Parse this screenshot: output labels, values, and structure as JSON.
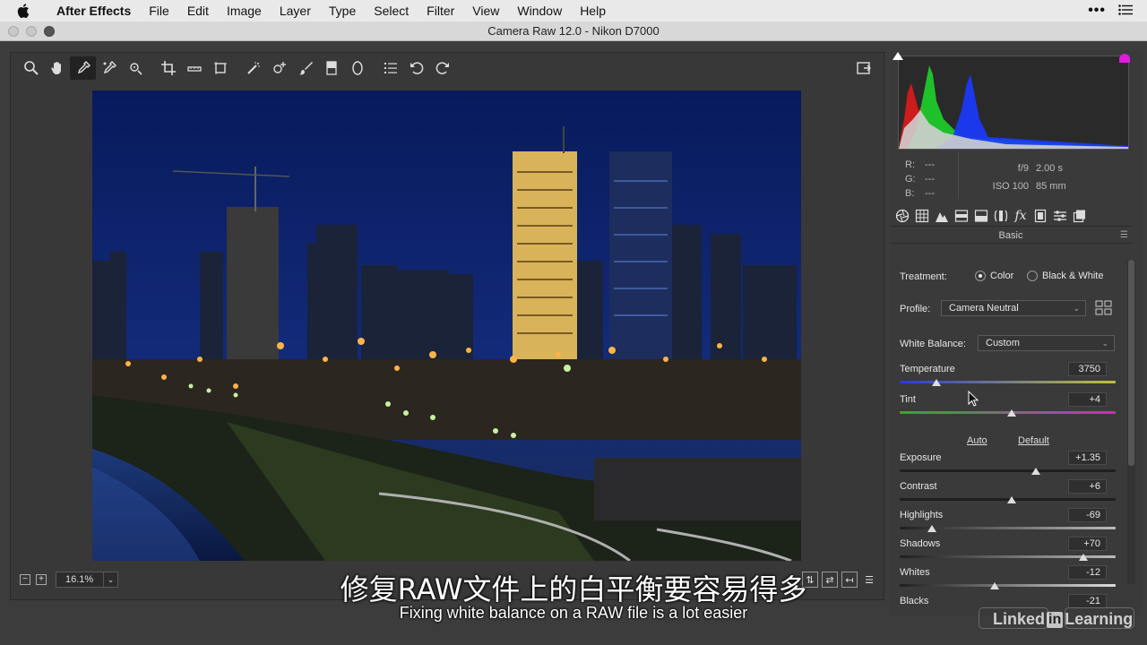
{
  "menubar": {
    "app": "After Effects",
    "items": [
      "File",
      "Edit",
      "Image",
      "Layer",
      "Type",
      "Select",
      "Filter",
      "View",
      "Window",
      "Help"
    ]
  },
  "window": {
    "title": "Camera Raw 12.0  -  Nikon D7000"
  },
  "toolbar": {
    "tools": [
      "zoom-tool",
      "hand-tool",
      "white-balance-tool",
      "color-sampler-tool",
      "targeted-adjustment-tool",
      "crop-tool",
      "straighten-tool",
      "transform-tool",
      "spot-removal-tool",
      "red-eye-tool",
      "adjustment-brush",
      "graduated-filter",
      "radial-filter",
      "preferences",
      "rotate-left",
      "rotate-right"
    ],
    "active_tool": "white-balance-tool"
  },
  "bottom": {
    "zoom_out": "−",
    "zoom_in": "+",
    "zoom": "16.1%"
  },
  "info": {
    "r_label": "R:",
    "r_value": "---",
    "g_label": "G:",
    "g_value": "---",
    "b_label": "B:",
    "b_value": "---",
    "aperture": "f/9",
    "shutter": "2.00 s",
    "iso": "ISO 100",
    "focal": "85 mm"
  },
  "panel": {
    "section": "Basic",
    "treatment_label": "Treatment:",
    "treatment_color": "Color",
    "treatment_bw": "Black & White",
    "profile_label": "Profile:",
    "profile_value": "Camera Neutral",
    "wb_label": "White Balance:",
    "wb_value": "Custom",
    "auto": "Auto",
    "default": "Default",
    "sliders": [
      {
        "label": "Temperature",
        "value": "3750",
        "position": 0.17
      },
      {
        "label": "Tint",
        "value": "+4",
        "position": 0.52
      },
      {
        "label": "Exposure",
        "value": "+1.35",
        "position": 0.63
      },
      {
        "label": "Contrast",
        "value": "+6",
        "position": 0.52
      },
      {
        "label": "Highlights",
        "value": "-69",
        "position": 0.15
      },
      {
        "label": "Shadows",
        "value": "+70",
        "position": 0.85
      },
      {
        "label": "Whites",
        "value": "-12",
        "position": 0.44
      },
      {
        "label": "Blacks",
        "value": "-21",
        "position": 0.4
      }
    ]
  },
  "subtitles": {
    "chinese": "修复RAW文件上的白平衡要容易得多",
    "english": "Fixing white balance on a RAW file is a lot easier"
  },
  "watermark": {
    "left": "Linked",
    "in": "in",
    "right": "Learning"
  },
  "colors": {
    "menubar": "#e9e9ea",
    "panel": "#3a3a3a",
    "sky": "#0b1a4a"
  }
}
